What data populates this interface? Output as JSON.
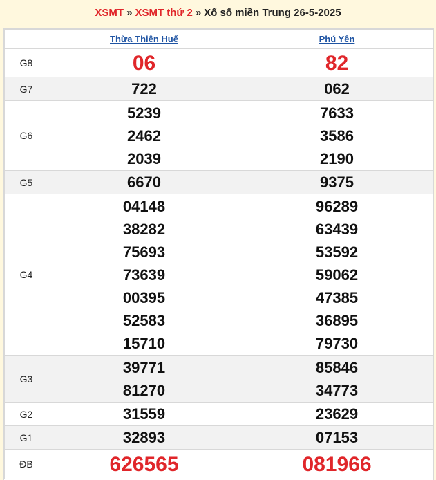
{
  "breadcrumb": {
    "link1": "XSMT",
    "separator": "»",
    "link2": "XSMT thứ 2",
    "title": "Xổ số miền Trung 26-5-2025"
  },
  "table": {
    "provinces": [
      "Thừa Thiên Huế",
      "Phú Yên"
    ],
    "rows": [
      {
        "label": "G8",
        "p1": [
          "06"
        ],
        "p2": [
          "82"
        ]
      },
      {
        "label": "G7",
        "p1": [
          "722"
        ],
        "p2": [
          "062"
        ]
      },
      {
        "label": "G6",
        "p1": [
          "5239",
          "2462",
          "2039"
        ],
        "p2": [
          "7633",
          "3586",
          "2190"
        ]
      },
      {
        "label": "G5",
        "p1": [
          "6670"
        ],
        "p2": [
          "9375"
        ]
      },
      {
        "label": "G4",
        "p1": [
          "04148",
          "38282",
          "75693",
          "73639",
          "00395",
          "52583",
          "15710"
        ],
        "p2": [
          "96289",
          "63439",
          "53592",
          "59062",
          "47385",
          "36895",
          "79730"
        ]
      },
      {
        "label": "G3",
        "p1": [
          "39771",
          "81270"
        ],
        "p2": [
          "85846",
          "34773"
        ]
      },
      {
        "label": "G2",
        "p1": [
          "31559"
        ],
        "p2": [
          "23629"
        ]
      },
      {
        "label": "G1",
        "p1": [
          "32893"
        ],
        "p2": [
          "07153"
        ]
      },
      {
        "label": "ĐB",
        "p1": [
          "626565"
        ],
        "p2": [
          "081966"
        ]
      }
    ]
  },
  "colors": {
    "accent_red": "#e0262a",
    "link_blue": "#1f54a3",
    "header_bg": "#fff8de"
  }
}
